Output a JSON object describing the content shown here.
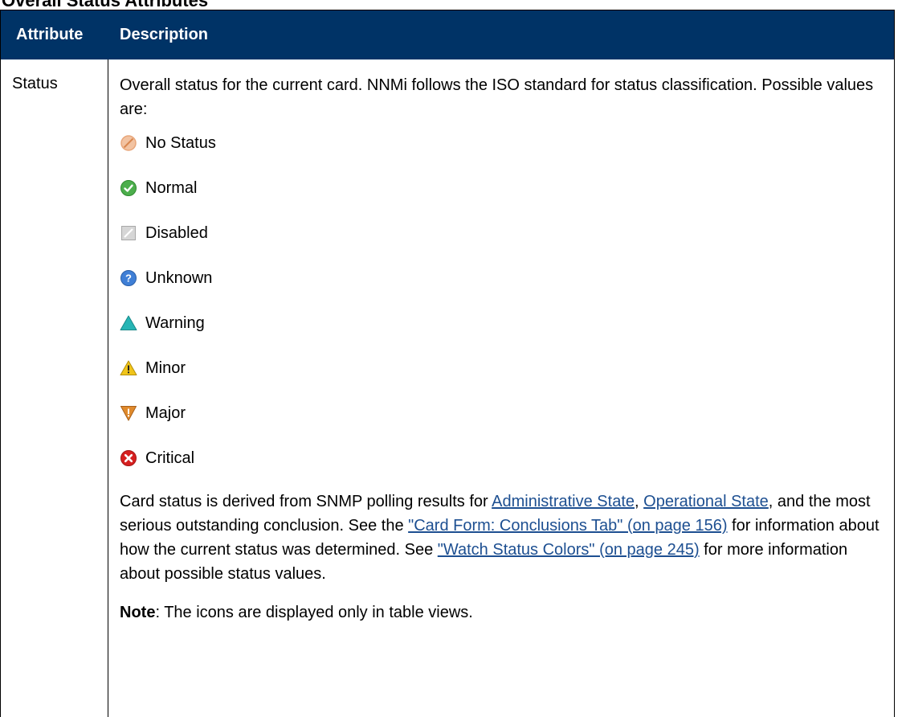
{
  "section_title": "Overall Status Attributes",
  "table": {
    "headers": {
      "attribute": "Attribute",
      "description": "Description"
    },
    "row": {
      "attribute": "Status",
      "intro": "Overall status for the current card. NNMi follows the ISO standard for status classification. Possible values are:",
      "statuses": [
        {
          "label": "No Status",
          "icon": "no-status-icon",
          "color": "#e8a67a"
        },
        {
          "label": "Normal",
          "icon": "normal-check-icon",
          "color": "#4cae4c"
        },
        {
          "label": "Disabled",
          "icon": "disabled-icon",
          "color": "#b9b9b9"
        },
        {
          "label": "Unknown",
          "icon": "unknown-question-icon",
          "color": "#3f7fd6"
        },
        {
          "label": "Warning",
          "icon": "warning-triangle-icon",
          "color": "#26b5b5"
        },
        {
          "label": "Minor",
          "icon": "minor-triangle-icon",
          "color": "#f0c419"
        },
        {
          "label": "Major",
          "icon": "major-triangle-icon",
          "color": "#e08a2c"
        },
        {
          "label": "Critical",
          "icon": "critical-x-icon",
          "color": "#d62020"
        }
      ],
      "paragraph": {
        "t1": "Card status is derived from SNMP polling results for ",
        "link_admin": "Administrative State",
        "t2": ", ",
        "link_oper": "Operational State",
        "t3": ", and the most serious outstanding conclusion. See the ",
        "link_conclusions": "\"Card Form: Conclusions Tab\" (on page 156)",
        "t4": " for information about how the current status was determined. See ",
        "link_colors": "\"Watch Status Colors\" (on page 245)",
        "t5": " for more information about possible status values."
      },
      "note": {
        "label": "Note",
        "text": ": The icons are displayed only in table views."
      }
    }
  },
  "link_color": "#1d4f91",
  "header_bg": "#003366"
}
